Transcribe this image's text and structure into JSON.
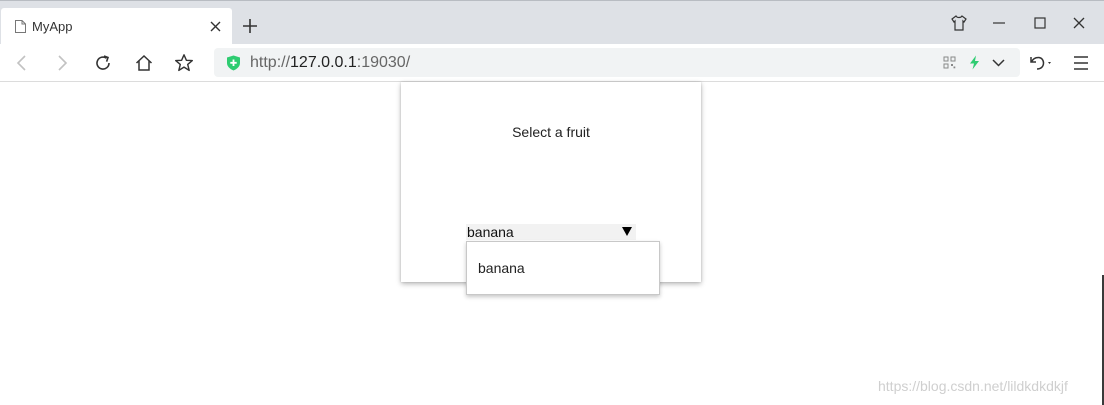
{
  "browser": {
    "tab": {
      "title": "MyApp"
    },
    "url": {
      "scheme": "http://",
      "host": "127.0.0.1",
      "rest": ":19030/"
    }
  },
  "page": {
    "prompt": "Select a fruit",
    "select": {
      "value": "banana",
      "options": [
        "banana"
      ]
    }
  },
  "watermark": "https://blog.csdn.net/lildkdkdkjf",
  "colors": {
    "tabstrip": "#dee1e6",
    "address_bar": "#f1f3f4",
    "shield": "#2ecc71",
    "bolt": "#2ecc71"
  },
  "icons": [
    "page-icon",
    "close-icon",
    "plus-icon",
    "skin-icon",
    "minimize-icon",
    "maximize-icon",
    "back-icon",
    "forward-icon",
    "reload-icon",
    "home-icon",
    "star-icon",
    "shield-icon",
    "qr-icon",
    "bolt-icon",
    "chevron-down-icon",
    "undo-icon",
    "menu-icon"
  ]
}
